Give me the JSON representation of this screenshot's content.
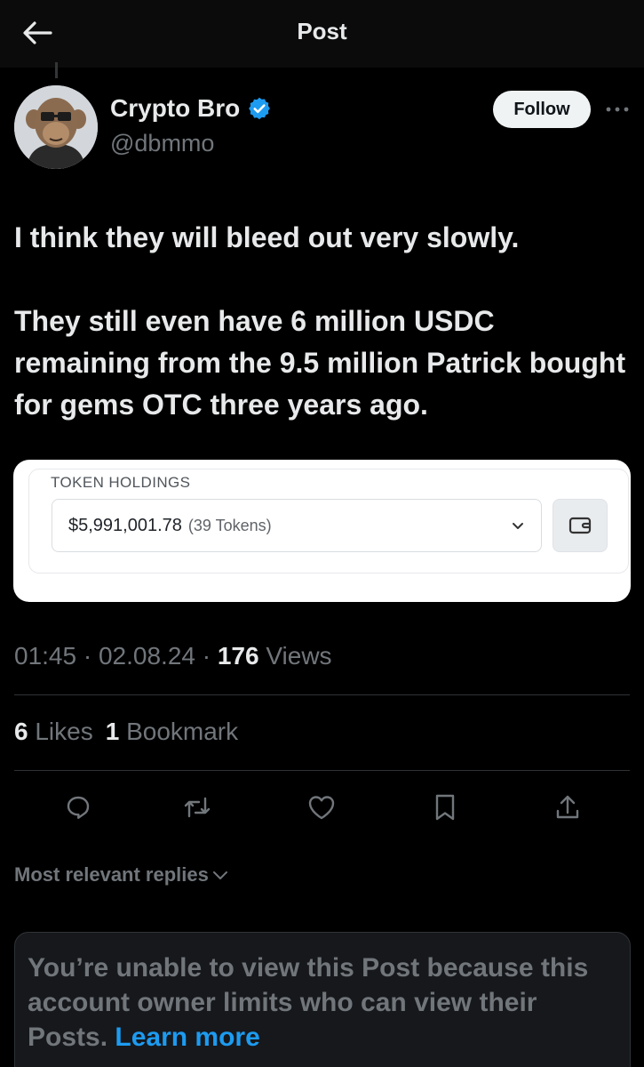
{
  "header": {
    "title": "Post",
    "back_icon": "arrow-left-icon"
  },
  "author": {
    "display_name": "Crypto Bro",
    "handle": "@dbmmo",
    "verified": true,
    "verified_color": "#1d9bf0",
    "follow_label": "Follow"
  },
  "post": {
    "paragraphs": [
      "I think they will bleed out very slowly.",
      "They still even have 6 million USDC remaining from the 9.5 million Patrick bought for gems OTC three years ago."
    ]
  },
  "attachment": {
    "label": "TOKEN HOLDINGS",
    "value": "$5,991,001.78",
    "count": "(39 Tokens)"
  },
  "meta": {
    "time": "01:45",
    "sep1": " · ",
    "date": "02.08.24",
    "sep2": " · ",
    "views_count": "176",
    "views_label": "Views"
  },
  "stats": {
    "likes_count": "6",
    "likes_label": "Likes",
    "bookmarks_count": "1",
    "bookmarks_label": "Bookmark"
  },
  "actions": [
    "reply-icon",
    "repost-icon",
    "like-icon",
    "bookmark-icon",
    "share-icon"
  ],
  "replies": {
    "sort_label": "Most relevant replies"
  },
  "notice": {
    "text": "You’re unable to view this Post because this account owner limits who can view their Posts.",
    "link": "Learn more"
  },
  "colors": {
    "background": "#000000",
    "text": "#e7e9ea",
    "muted": "#71767b",
    "link": "#1d9bf0"
  }
}
